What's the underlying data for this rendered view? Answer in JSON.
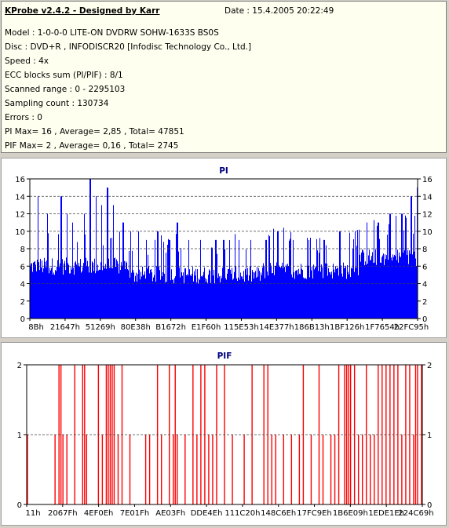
{
  "header": {
    "title": "KProbe v2.4.2 - Designed by Karr",
    "date": "Date : 15.4.2005 20:22:49"
  },
  "info_lines": [
    "Model : 1-0-0-0 LITE-ON DVDRW SOHW-1633S BS0S",
    "Disc : DVD+R , INFODISCR20 [Infodisc Technology Co., Ltd.]",
    "Speed : 4x",
    "ECC blocks sum (PI/PIF) : 8/1",
    "Scanned range : 0 - 2295103",
    "Sampling count : 130734",
    "Errors : 0",
    "PI Max= 16 , Average= 2,85 , Total= 47851",
    "PIF Max= 2 , Average= 0,16 , Total= 2745"
  ],
  "chart_data": [
    {
      "type": "bar",
      "title": "PI",
      "color": "#0000ff",
      "ylim": [
        0,
        16
      ],
      "yticks": [
        0,
        2,
        4,
        6,
        8,
        10,
        12,
        14,
        16
      ],
      "dashed_gridlines": [
        4,
        6,
        8,
        10,
        12,
        14
      ],
      "xtick_labels": [
        "8Bh",
        "21647h",
        "51269h",
        "80E38h",
        "B1672h",
        "E1F60h",
        "115E53h",
        "14E377h",
        "186B13h",
        "1BF126h",
        "1F7654h",
        "22FC95h"
      ],
      "summary": {
        "max": 16,
        "average": 2.85,
        "total": 47851
      },
      "peaks": [
        {
          "pos": 0.0,
          "value": 6
        },
        {
          "pos": 0.02,
          "value": 14
        },
        {
          "pos": 0.045,
          "value": 12
        },
        {
          "pos": 0.08,
          "value": 14
        },
        {
          "pos": 0.095,
          "value": 12
        },
        {
          "pos": 0.11,
          "value": 11
        },
        {
          "pos": 0.14,
          "value": 12
        },
        {
          "pos": 0.155,
          "value": 16
        },
        {
          "pos": 0.17,
          "value": 14
        },
        {
          "pos": 0.185,
          "value": 13
        },
        {
          "pos": 0.2,
          "value": 15
        },
        {
          "pos": 0.215,
          "value": 13
        },
        {
          "pos": 0.24,
          "value": 11
        },
        {
          "pos": 0.26,
          "value": 10
        },
        {
          "pos": 0.28,
          "value": 10
        },
        {
          "pos": 0.3,
          "value": 9
        },
        {
          "pos": 0.33,
          "value": 10
        },
        {
          "pos": 0.36,
          "value": 9
        },
        {
          "pos": 0.38,
          "value": 11
        },
        {
          "pos": 0.41,
          "value": 9
        },
        {
          "pos": 0.44,
          "value": 9
        },
        {
          "pos": 0.48,
          "value": 9
        },
        {
          "pos": 0.5,
          "value": 9
        },
        {
          "pos": 0.54,
          "value": 9
        },
        {
          "pos": 0.57,
          "value": 9
        },
        {
          "pos": 0.61,
          "value": 9
        },
        {
          "pos": 0.64,
          "value": 10
        },
        {
          "pos": 0.68,
          "value": 9
        },
        {
          "pos": 0.72,
          "value": 9
        },
        {
          "pos": 0.76,
          "value": 9
        },
        {
          "pos": 0.8,
          "value": 10
        },
        {
          "pos": 0.84,
          "value": 10
        },
        {
          "pos": 0.87,
          "value": 11
        },
        {
          "pos": 0.9,
          "value": 11
        },
        {
          "pos": 0.93,
          "value": 12
        },
        {
          "pos": 0.96,
          "value": 12
        },
        {
          "pos": 0.985,
          "value": 14
        },
        {
          "pos": 1.0,
          "value": 15
        }
      ],
      "baseline_bands": [
        {
          "from": 0.0,
          "to": 0.25,
          "base": 6
        },
        {
          "from": 0.25,
          "to": 0.6,
          "base": 5
        },
        {
          "from": 0.6,
          "to": 0.85,
          "base": 5.5
        },
        {
          "from": 0.85,
          "to": 1.0,
          "base": 7
        }
      ]
    },
    {
      "type": "bar",
      "title": "PIF",
      "color": "#ff0000",
      "ylim": [
        0,
        2
      ],
      "yticks": [
        0,
        1,
        2
      ],
      "dashed_gridlines": [
        1
      ],
      "xtick_labels": [
        "11h",
        "2067Fh",
        "4EF0Eh",
        "7E01Fh",
        "AE03Fh",
        "DDE4Eh",
        "111C20h",
        "148C6Eh",
        "17FC9Eh",
        "1B6E09h",
        "1EDE1Eh",
        "224C69h"
      ],
      "summary": {
        "max": 2,
        "average": 0.16,
        "total": 2745
      },
      "spikes_value_2": [
        0.08,
        0.085,
        0.12,
        0.14,
        0.145,
        0.18,
        0.2,
        0.205,
        0.21,
        0.215,
        0.22,
        0.24,
        0.33,
        0.36,
        0.375,
        0.42,
        0.44,
        0.45,
        0.48,
        0.5,
        0.57,
        0.6,
        0.61,
        0.7,
        0.74,
        0.79,
        0.805,
        0.81,
        0.815,
        0.82,
        0.83,
        0.86,
        0.89,
        0.9,
        0.91,
        0.92,
        0.93,
        0.94,
        0.96,
        0.97,
        0.985,
        0.99,
        1.0
      ],
      "spikes_value_1": [
        0.0,
        0.07,
        0.09,
        0.1,
        0.15,
        0.19,
        0.23,
        0.26,
        0.3,
        0.31,
        0.34,
        0.37,
        0.38,
        0.4,
        0.43,
        0.46,
        0.47,
        0.52,
        0.55,
        0.62,
        0.63,
        0.65,
        0.67,
        0.69,
        0.72,
        0.75,
        0.77,
        0.78,
        0.84,
        0.85,
        0.87,
        0.88,
        0.95,
        0.98
      ]
    }
  ]
}
